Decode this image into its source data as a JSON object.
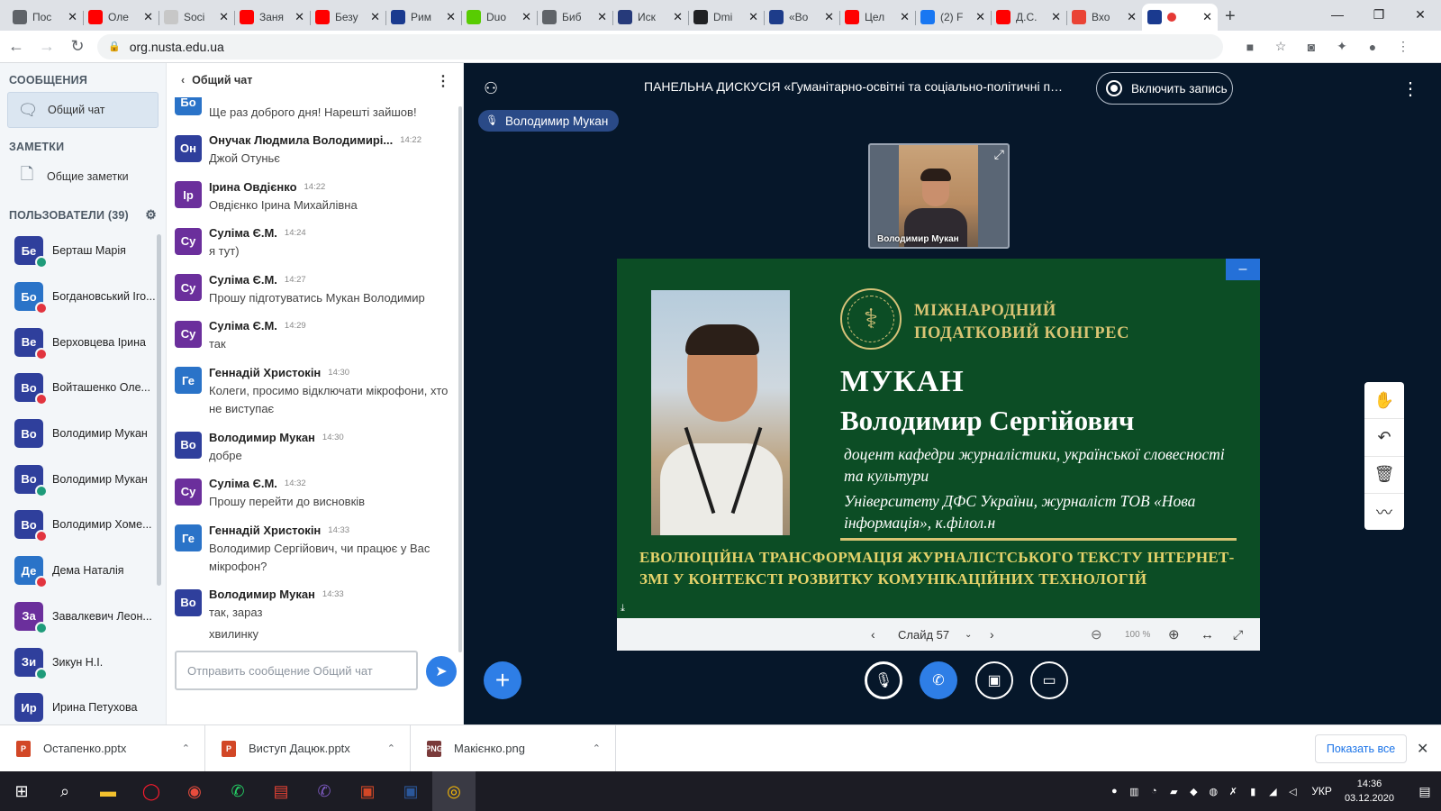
{
  "browser": {
    "tabs": [
      {
        "title": "Пос",
        "color": "#5f6368"
      },
      {
        "title": "Оле",
        "color": "#ff0000"
      },
      {
        "title": "Soci",
        "color": "#c7c7c7"
      },
      {
        "title": "Заня",
        "color": "#ff0000"
      },
      {
        "title": "Безу",
        "color": "#ff0000"
      },
      {
        "title": "Рим",
        "color": "#1a3a8f"
      },
      {
        "title": "Duo",
        "color": "#58cc02"
      },
      {
        "title": "Биб",
        "color": "#5f6368"
      },
      {
        "title": "Иск",
        "color": "#263a7a"
      },
      {
        "title": "Dmi",
        "color": "#202124"
      },
      {
        "title": "«Во",
        "color": "#1d3c8a"
      },
      {
        "title": "Цел",
        "color": "#ff0000"
      },
      {
        "title": "(2) F",
        "color": "#1877f2"
      },
      {
        "title": "Д.С.",
        "color": "#ff0000"
      },
      {
        "title": "Вхо",
        "color": "#ea4335"
      },
      {
        "title": "",
        "color": "#1a3a8f"
      }
    ],
    "url": "org.nusta.edu.ua"
  },
  "sidebar": {
    "messages_header": "СООБЩЕНИЯ",
    "public_chat": "Общий чат",
    "notes_header": "ЗАМЕТКИ",
    "shared_notes": "Общие заметки",
    "users_header": "ПОЛЬЗОВАТЕЛИ (39)",
    "users": [
      {
        "initials": "Бе",
        "name": "Берташ Марія",
        "color": "#2f3f9c",
        "status": "#1e9b7a"
      },
      {
        "initials": "Бо",
        "name": "Богдановський Іго...",
        "color": "#2a73c8",
        "status": "#e2343f"
      },
      {
        "initials": "Ве",
        "name": "Верховцева Ірина",
        "color": "#2f3f9c",
        "status": "#e2343f"
      },
      {
        "initials": "Во",
        "name": "Войташенко Оле...",
        "color": "#2f3f9c",
        "status": "#e2343f"
      },
      {
        "initials": "Во",
        "name": "Володимир Мукан",
        "color": "#2f3f9c",
        "status": ""
      },
      {
        "initials": "Во",
        "name": "Володимир Мукан",
        "color": "#2f3f9c",
        "status": "#1e9b7a"
      },
      {
        "initials": "Во",
        "name": "Володимир Хоме...",
        "color": "#2f3f9c",
        "status": "#e2343f"
      },
      {
        "initials": "Де",
        "name": "Дема Наталія",
        "color": "#2a73c8",
        "status": "#e2343f"
      },
      {
        "initials": "За",
        "name": "Завалкевич Леон...",
        "color": "#6b2f9c",
        "status": "#1e9b7a"
      },
      {
        "initials": "Зи",
        "name": "Зикун Н.І.",
        "color": "#2f3f9c",
        "status": "#1e9b7a"
      },
      {
        "initials": "Ир",
        "name": "Ирина Петухова",
        "color": "#2f3f9c",
        "status": ""
      }
    ]
  },
  "chat": {
    "title": "Общий чат",
    "messages": [
      {
        "initials": "Бо",
        "color": "#2a73c8",
        "name": "",
        "time": "",
        "text": "Ще раз доброго дня! Нарешті зайшов!"
      },
      {
        "initials": "Он",
        "color": "#2f3f9c",
        "name": "Онучак Людмила Володимирі...",
        "time": "14:22",
        "text": "Джой Отуньє"
      },
      {
        "initials": "Ір",
        "color": "#6b2f9c",
        "name": "Ірина Овдієнко",
        "time": "14:22",
        "text": "Овдієнко Ірина Михайлівна"
      },
      {
        "initials": "Су",
        "color": "#6b2f9c",
        "name": "Суліма Є.М.",
        "time": "14:24",
        "text": "я тут)"
      },
      {
        "initials": "Су",
        "color": "#6b2f9c",
        "name": "Суліма Є.М.",
        "time": "14:27",
        "text": "Прошу підготуватись Мукан Володимир"
      },
      {
        "initials": "Су",
        "color": "#6b2f9c",
        "name": "Суліма Є.М.",
        "time": "14:29",
        "text": "так"
      },
      {
        "initials": "Ге",
        "color": "#2a73c8",
        "name": "Геннадій Христокін",
        "time": "14:30",
        "text": "Колеги, просимо відключати мікрофони, хто не виступає"
      },
      {
        "initials": "Во",
        "color": "#2f3f9c",
        "name": "Володимир Мукан",
        "time": "14:30",
        "text": "добре"
      },
      {
        "initials": "Су",
        "color": "#6b2f9c",
        "name": "Суліма Є.М.",
        "time": "14:32",
        "text": "Прошу перейти до висновків"
      },
      {
        "initials": "Ге",
        "color": "#2a73c8",
        "name": "Геннадій Христокін",
        "time": "14:33",
        "text": "Володимир Сергійович, чи працює у Вас мікрофон?"
      },
      {
        "initials": "Во",
        "color": "#2f3f9c",
        "name": "Володимир Мукан",
        "time": "14:33",
        "text": "так, зараз"
      }
    ],
    "continuation": "хвилинку",
    "input_placeholder": "Отправить сообщение Общий чат"
  },
  "stage": {
    "meeting_title": "ПАНЕЛЬНА ДИСКУСІЯ «Гуманітарно-освітні та соціально-політичні проц...",
    "record_label": "Включить запись",
    "talker": "Володимир Мукан",
    "webcam_label": "Володимир Мукан",
    "slide": {
      "congress_line1": "МІЖНАРОДНИЙ",
      "congress_line2": "ПОДАТКОВИЙ КОНГРЕС",
      "surname": "МУКАН",
      "given_names": "Володимир Сергійович",
      "position1": "доцент кафедри журналістики, української словесності та культури",
      "position2": "Університету ДФС України, журналіст ТОВ «Нова інформація», к.філол.н",
      "topic": "ЕВОЛЮЦІЙНА ТРАНСФОРМАЦІЯ ЖУРНАЛІСТСЬКОГО ТЕКСТУ ІНТЕРНЕТ-ЗМІ У КОНТЕКСТІ РОЗВИТКУ КОМУНІКАЦІЙНИХ ТЕХНОЛОГІЙ"
    },
    "slide_label": "Слайд 57",
    "zoom": "100 %"
  },
  "downloads": {
    "items": [
      {
        "name": "Остапенко.pptx",
        "icon_color": "#d24726",
        "icon_text": "P"
      },
      {
        "name": "Виступ Дацюк.pptx",
        "icon_color": "#d24726",
        "icon_text": "P"
      },
      {
        "name": "Макієнко.png",
        "icon_color": "#7a3a3a",
        "icon_text": "PNG"
      }
    ],
    "show_all": "Показать все"
  },
  "taskbar": {
    "lang": "УКР",
    "time": "14:36",
    "date": "03.12.2020"
  }
}
